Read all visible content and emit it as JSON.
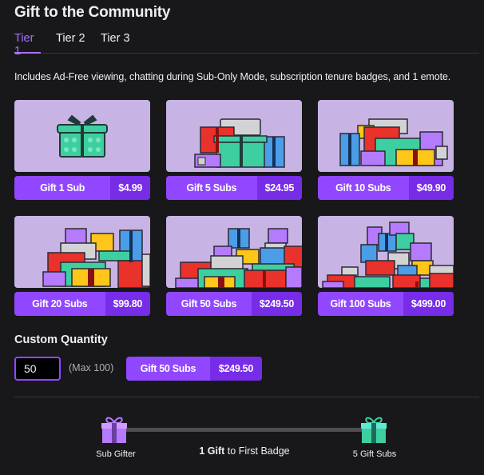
{
  "header": {
    "title": "Gift to the Community"
  },
  "tabs": [
    {
      "label": "Tier 1",
      "active": true
    },
    {
      "label": "Tier 2",
      "active": false
    },
    {
      "label": "Tier 3",
      "active": false
    }
  ],
  "description": "Includes Ad-Free viewing, chatting during Sub-Only Mode, subscription tenure badges, and 1 emote.",
  "options": [
    {
      "label": "Gift 1 Sub",
      "price": "$4.99",
      "art": "single-gift-icon"
    },
    {
      "label": "Gift 5 Subs",
      "price": "$24.95",
      "art": "gift-pile-5-icon"
    },
    {
      "label": "Gift 10 Subs",
      "price": "$49.90",
      "art": "gift-pile-10-icon"
    },
    {
      "label": "Gift 20 Subs",
      "price": "$99.80",
      "art": "gift-pile-20-icon"
    },
    {
      "label": "Gift 50 Subs",
      "price": "$249.50",
      "art": "gift-pile-50-icon"
    },
    {
      "label": "Gift 100 Subs",
      "price": "$499.00",
      "art": "gift-pile-100-icon"
    }
  ],
  "custom": {
    "label": "Custom Quantity",
    "value": "50",
    "max_hint": "(Max 100)",
    "button_label": "Gift 50 Subs",
    "button_price": "$249.50"
  },
  "progress": {
    "start_label": "Sub Gifter",
    "end_label": "5 Gift Subs",
    "count_text": "1 Gift",
    "rest_text": " to First Badge"
  },
  "colors": {
    "accent": "#9147ff",
    "accent_dark": "#772ce8",
    "tab_active": "#a970ff",
    "card_bg": "#c8b4e4",
    "background": "#18181b"
  }
}
